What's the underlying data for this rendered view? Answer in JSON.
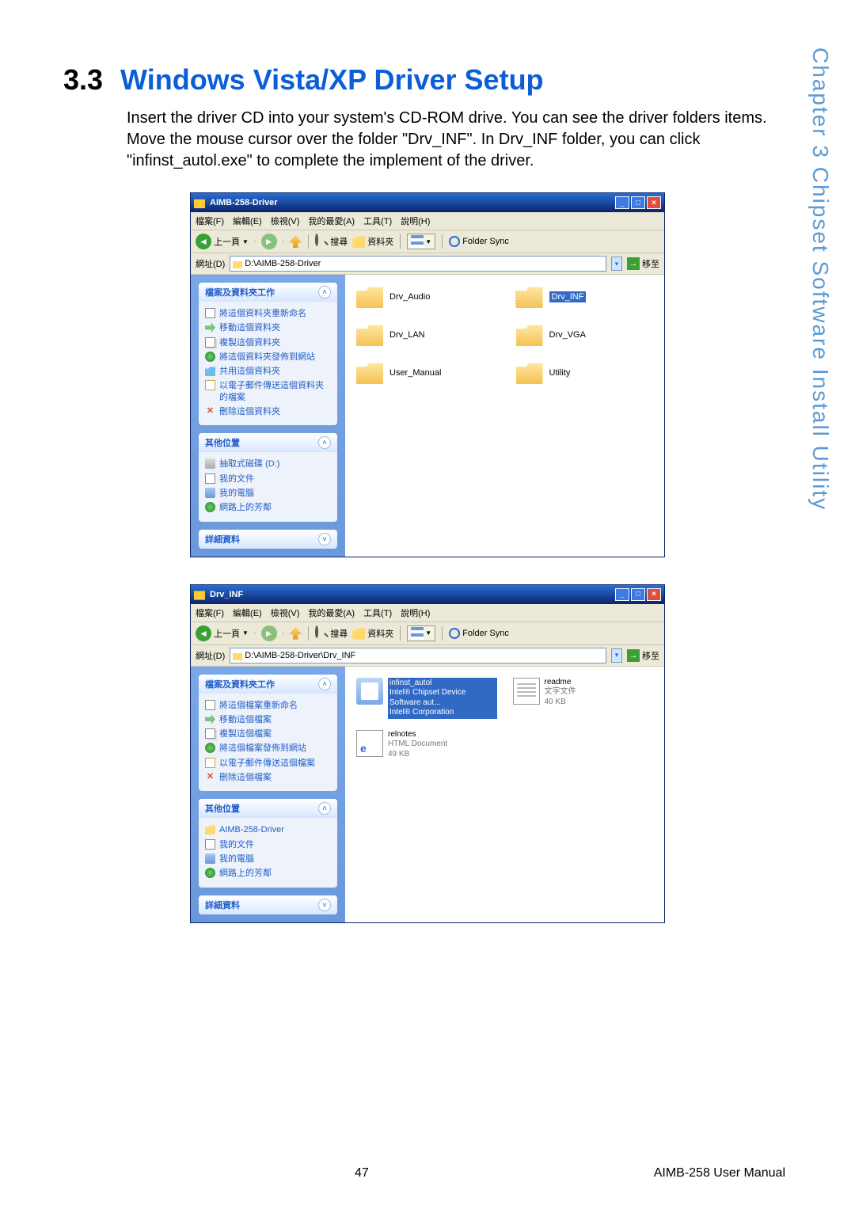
{
  "side_label": "Chapter 3  Chipset Software Install Utility",
  "section": {
    "number": "3.3",
    "title": "Windows Vista/XP Driver Setup"
  },
  "paragraph": "Insert the driver CD into your system's CD-ROM drive. You can see the driver folders items. Move the mouse cursor over the folder \"Drv_INF\". In Drv_INF folder, you can click \"infinst_autol.exe\" to complete the implement of the driver.",
  "explorer1": {
    "title": "AIMB-258-Driver",
    "menu": [
      "檔案(F)",
      "編輯(E)",
      "檢視(V)",
      "我的最愛(A)",
      "工具(T)",
      "說明(H)"
    ],
    "toolbar": {
      "back": "上一頁",
      "search": "搜尋",
      "folders": "資料夾",
      "foldersync": "Folder Sync"
    },
    "address_label": "網址(D)",
    "address": "D:\\AIMB-258-Driver",
    "go": "移至",
    "task_panel_title": "檔案及資料夾工作",
    "tasks": [
      "將這個資料夾重新命名",
      "移動這個資料夾",
      "複製這個資料夾",
      "將這個資料夾發佈到網站",
      "共用這個資料夾",
      "以電子郵件傳送這個資料夾的檔案",
      "刪除這個資料夾"
    ],
    "other_panel_title": "其他位置",
    "others": [
      "抽取式磁碟 (D:)",
      "我的文件",
      "我的電腦",
      "網路上的芳鄰"
    ],
    "details_panel_title": "詳細資料",
    "folders": [
      "Drv_Audio",
      "Drv_INF",
      "Drv_LAN",
      "Drv_VGA",
      "User_Manual",
      "Utility"
    ],
    "selected_folder": "Drv_INF"
  },
  "explorer2": {
    "title": "Drv_INF",
    "menu": [
      "檔案(F)",
      "編輯(E)",
      "檢視(V)",
      "我的最愛(A)",
      "工具(T)",
      "說明(H)"
    ],
    "toolbar": {
      "back": "上一頁",
      "search": "搜尋",
      "folders": "資料夾",
      "foldersync": "Folder Sync"
    },
    "address_label": "網址(D)",
    "address": "D:\\AIMB-258-Driver\\Drv_INF",
    "go": "移至",
    "task_panel_title": "檔案及資料夾工作",
    "tasks": [
      "將這個檔案重新命名",
      "移動這個檔案",
      "複製這個檔案",
      "將這個檔案發佈到網站",
      "以電子郵件傳送這個檔案",
      "刪除這個檔案"
    ],
    "other_panel_title": "其他位置",
    "others": [
      "AIMB-258-Driver",
      "我的文件",
      "我的電腦",
      "網路上的芳鄰"
    ],
    "details_panel_title": "詳細資料",
    "files": [
      {
        "name": "infinst_autol",
        "sub1": "Intel® Chipset Device Software aut...",
        "sub2": "Intel® Corporation",
        "type": "installer",
        "selected": true
      },
      {
        "name": "readme",
        "sub1": "文字文件",
        "sub2": "40 KB",
        "type": "txt",
        "selected": false
      },
      {
        "name": "relnotes",
        "sub1": "HTML Document",
        "sub2": "49 KB",
        "type": "html",
        "selected": false
      }
    ]
  },
  "footer": {
    "page": "47",
    "manual": "AIMB-258 User Manual"
  }
}
